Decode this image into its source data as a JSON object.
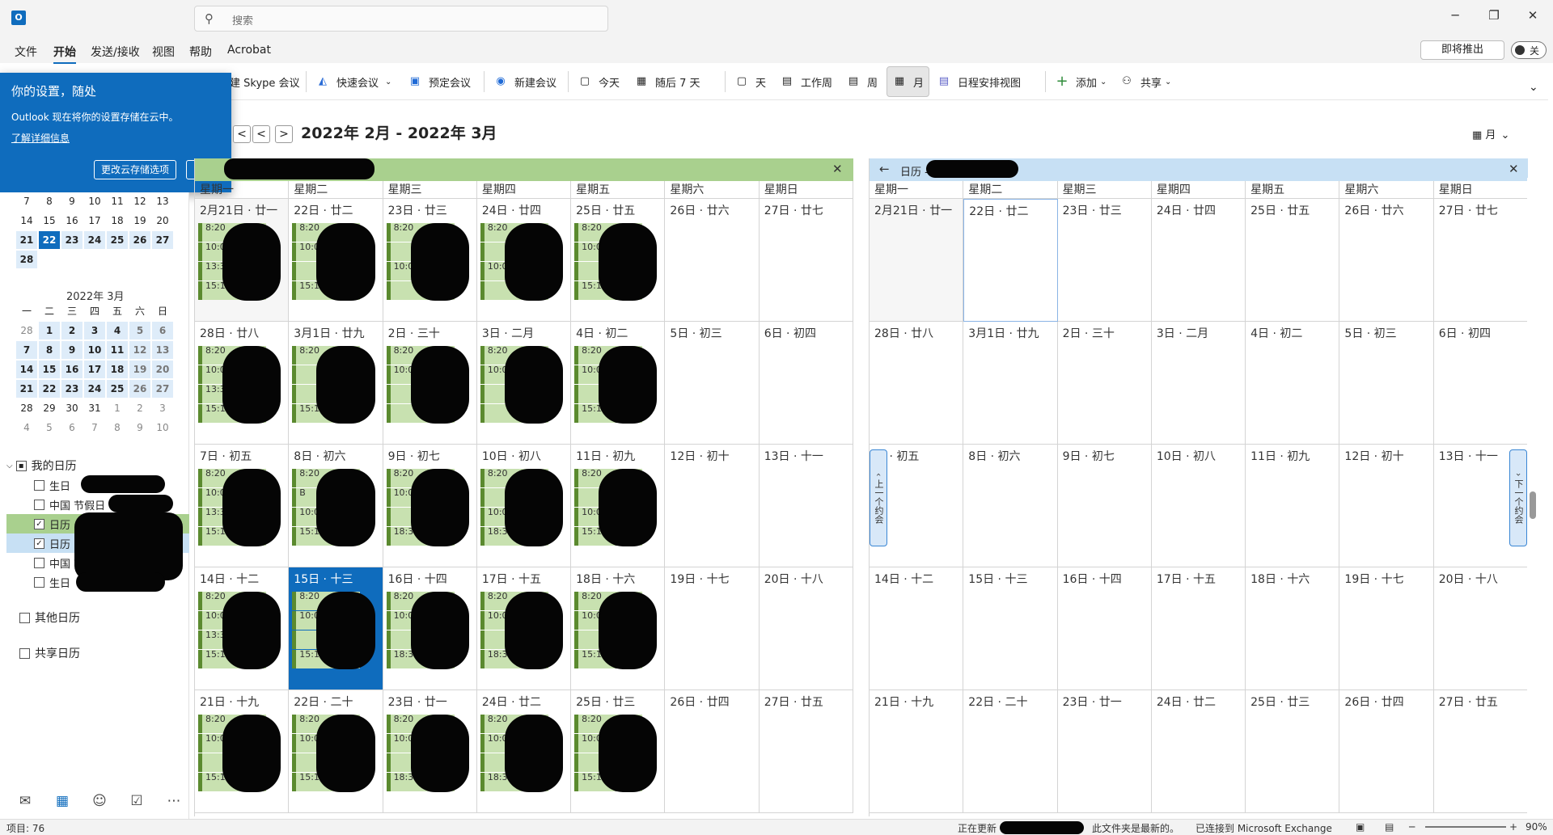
{
  "titlebar": {
    "logo": "O",
    "search_placeholder": "搜索",
    "minimize": "─",
    "maximize": "❐",
    "close": "✕"
  },
  "menu": {
    "items": [
      "文件",
      "开始",
      "发送/接收",
      "视图",
      "帮助",
      "Acrobat"
    ],
    "coming_soon": "即将推出",
    "toggle_label": "关"
  },
  "ribbon": {
    "skype": "建 Skype 会议",
    "quick": "快速会议",
    "schedule": "预定会议",
    "new": "新建会议",
    "today": "今天",
    "next7": "随后 7 天",
    "day": "天",
    "workweek": "工作周",
    "week": "周",
    "month": "月",
    "schedule_view": "日程安排视图",
    "add": "添加",
    "share": "共享"
  },
  "callout": {
    "title": "你的设置，随处",
    "body": "Outlook 现在将你的设置存储在云中。",
    "link": "了解详细信息",
    "btn_change": "更改云存储选项",
    "btn_ok": "了解"
  },
  "header": {
    "date_range": "2022年 2月 - 2022年 3月",
    "view": "月",
    "prev": "<",
    "next": ">"
  },
  "mini_feb": {
    "rows": [
      [
        "7",
        "8",
        "9",
        "10",
        "11",
        "12",
        "13"
      ],
      [
        "14",
        "15",
        "16",
        "17",
        "18",
        "19",
        "20"
      ],
      [
        "21",
        "22",
        "23",
        "24",
        "25",
        "26",
        "27"
      ],
      [
        "28"
      ]
    ]
  },
  "mini_mar": {
    "title": "2022年 3月",
    "dows": [
      "一",
      "二",
      "三",
      "四",
      "五",
      "六",
      "日"
    ],
    "rows": [
      [
        "28",
        "1",
        "2",
        "3",
        "4",
        "5",
        "6"
      ],
      [
        "7",
        "8",
        "9",
        "10",
        "11",
        "12",
        "13"
      ],
      [
        "14",
        "15",
        "16",
        "17",
        "18",
        "19",
        "20"
      ],
      [
        "21",
        "22",
        "23",
        "24",
        "25",
        "26",
        "27"
      ],
      [
        "28",
        "29",
        "30",
        "31",
        "1",
        "2",
        "3"
      ],
      [
        "4",
        "5",
        "6",
        "7",
        "8",
        "9",
        "10"
      ]
    ]
  },
  "nav": {
    "my_cal": "我的日历",
    "items": [
      "生日",
      "中国 节假日",
      "日历",
      "日历",
      "中国 节假日",
      "生日"
    ],
    "other": "其他日历",
    "shared": "共享日历"
  },
  "grid1": {
    "close": "✕",
    "dows": [
      "星期一",
      "星期二",
      "星期三",
      "星期四",
      "星期五",
      "星期六",
      "星期日"
    ],
    "weeks": [
      [
        "2月21日 · 廿一",
        "22日 · 廿二",
        "23日 · 廿三",
        "24日 · 廿四",
        "25日 · 廿五",
        "26日 · 廿六",
        "27日 · 廿七"
      ],
      [
        "28日 · 廿八",
        "3月1日 · 廿九",
        "2日 · 三十",
        "3日 · 二月",
        "4日 · 初二",
        "5日 · 初三",
        "6日 · 初四"
      ],
      [
        "7日 · 初五",
        "8日 · 初六",
        "9日 · 初七",
        "10日 · 初八",
        "11日 · 初九",
        "12日 · 初十",
        "13日 · 十一"
      ],
      [
        "14日 · 十二",
        "15日 · 十三",
        "16日 · 十四",
        "17日 · 十五",
        "18日 · 十六",
        "19日 · 十七",
        "20日 · 十八"
      ],
      [
        "21日 · 十九",
        "22日 · 二十",
        "23日 · 廿一",
        "24日 · 廿二",
        "25日 · 廿三",
        "26日 · 廿四",
        "27日 · 廿五"
      ]
    ],
    "events": [
      [
        [
          "8:20",
          "10:05",
          "13:30",
          "15:15"
        ],
        [
          "8:20",
          "10:0",
          "",
          "15:15"
        ],
        [
          "8:20",
          "",
          "10:05",
          ""
        ],
        [
          "8:20",
          "",
          "10:05",
          ""
        ],
        [
          "8:20",
          "10:05",
          "",
          "15:15"
        ]
      ],
      [
        [
          "8:20",
          "10:05",
          "13:30",
          "15:15"
        ],
        [
          "8:20",
          "",
          "",
          "15:15"
        ],
        [
          "8:20",
          "10:05",
          "",
          ""
        ],
        [
          "8:20",
          "10:05",
          "",
          ""
        ],
        [
          "8:20",
          "10:05",
          "",
          "15:1"
        ]
      ],
      [
        [
          "8:20",
          "10:05",
          "13:30",
          "15:15"
        ],
        [
          "8:20",
          "B",
          "10:05",
          "15:15"
        ],
        [
          "8:20",
          "10:05",
          "",
          "18:30"
        ],
        [
          "8:20",
          "",
          "10:05",
          "18:3"
        ],
        [
          "8:20",
          "",
          "10:05",
          "15:15"
        ]
      ],
      [
        [
          "8:20",
          "10:05",
          "13:30",
          "15:15"
        ],
        [
          "8:20",
          "10:05",
          "",
          "15:15"
        ],
        [
          "8:20",
          "10:05",
          "",
          "18:30"
        ],
        [
          "8:20",
          "10:05",
          "",
          "18:30"
        ],
        [
          "8:20",
          "10:05",
          "",
          "15:15"
        ]
      ],
      [
        [
          "8:20",
          "10:05",
          "",
          "15:15"
        ],
        [
          "8:20",
          "10:05",
          "",
          "15:15"
        ],
        [
          "8:20",
          "10:05",
          "",
          "18:30"
        ],
        [
          "8:20",
          "10:05",
          "",
          "18:30"
        ],
        [
          "8:20",
          "10:05",
          "",
          "15:15"
        ]
      ]
    ]
  },
  "grid2": {
    "title": "日历 -",
    "back": "←",
    "close": "✕",
    "dows": [
      "星期一",
      "星期二",
      "星期三",
      "星期四",
      "星期五",
      "星期六",
      "星期日"
    ],
    "weeks": [
      [
        "2月21日 · 廿一",
        "22日 · 廿二",
        "23日 · 廿三",
        "24日 · 廿四",
        "25日 · 廿五",
        "26日 · 廿六",
        "27日 · 廿七"
      ],
      [
        "28日 · 廿八",
        "3月1日 · 廿九",
        "2日 · 三十",
        "3日 · 二月",
        "4日 · 初二",
        "5日 · 初三",
        "6日 · 初四"
      ],
      [
        "日 · 初五",
        "8日 · 初六",
        "9日 · 初七",
        "10日 · 初八",
        "11日 · 初九",
        "12日 · 初十",
        "13日 · 十一"
      ],
      [
        "14日 · 十二",
        "15日 · 十三",
        "16日 · 十四",
        "17日 · 十五",
        "18日 · 十六",
        "19日 · 十七",
        "20日 · 十八"
      ],
      [
        "21日 · 十九",
        "22日 · 二十",
        "23日 · 廿一",
        "24日 · 廿二",
        "25日 · 廿三",
        "26日 · 廿四",
        "27日 · 廿五"
      ]
    ],
    "prev_appt": "上一个约会",
    "next_appt": "下一个约会"
  },
  "status": {
    "items": "项目: 76",
    "updating": "正在更新",
    "uptodate": "此文件夹是最新的。",
    "connected": "已连接到 Microsoft Exchange",
    "zoom": "90%",
    "minus": "─",
    "plus": "+"
  },
  "colors": {
    "accent": "#0f6cbd",
    "event_green": "#c8e1b0",
    "header_green": "#a9d08e",
    "header_blue": "#c7e0f4"
  }
}
